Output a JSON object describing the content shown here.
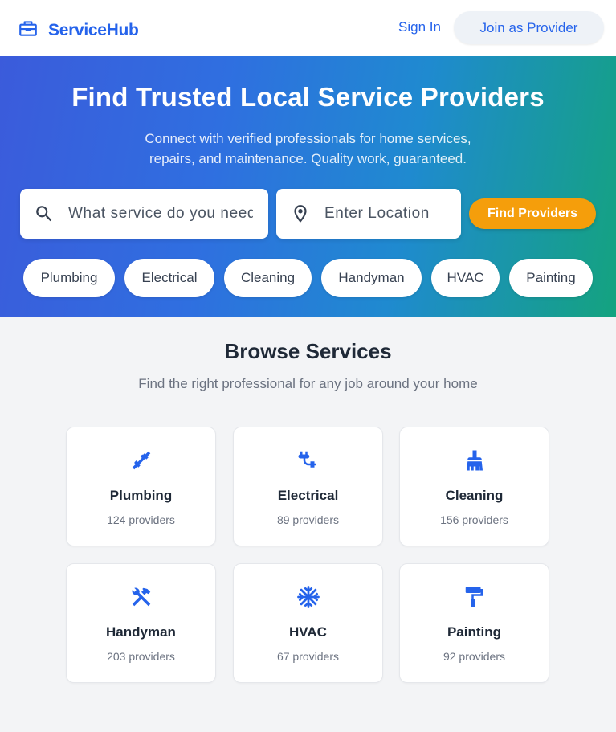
{
  "header": {
    "brand": "ServiceHub",
    "brand_icon": "toolbox-icon",
    "sign_in": "Sign In",
    "join": "Join as Provider"
  },
  "hero": {
    "title": "Find Trusted Local Service Providers",
    "subtitle_line1": "Connect with verified professionals for home services,",
    "subtitle_line2": "repairs, and maintenance. Quality work, guaranteed.",
    "service_placeholder": "What service do you need?",
    "location_placeholder": "Enter Location",
    "find_button": "Find Providers",
    "chips": [
      "Plumbing",
      "Electrical",
      "Cleaning",
      "Handyman",
      "HVAC",
      "Painting"
    ]
  },
  "browse": {
    "title": "Browse Services",
    "subtitle": "Find the right professional for any job around your home",
    "categories": [
      {
        "name": "Plumbing",
        "count": "124 providers",
        "icon": "pipe-wrench-icon"
      },
      {
        "name": "Electrical",
        "count": "89 providers",
        "icon": "power-plug-icon"
      },
      {
        "name": "Cleaning",
        "count": "156 providers",
        "icon": "broom-icon"
      },
      {
        "name": "Handyman",
        "count": "203 providers",
        "icon": "hammer-wrench-icon"
      },
      {
        "name": "HVAC",
        "count": "67 providers",
        "icon": "snowflake-icon"
      },
      {
        "name": "Painting",
        "count": "92 providers",
        "icon": "paint-roller-icon"
      }
    ]
  },
  "colors": {
    "primary": "#2563eb",
    "accent": "#f59e0b",
    "hero_start": "#3b5bdb",
    "hero_end": "#14a37f"
  }
}
